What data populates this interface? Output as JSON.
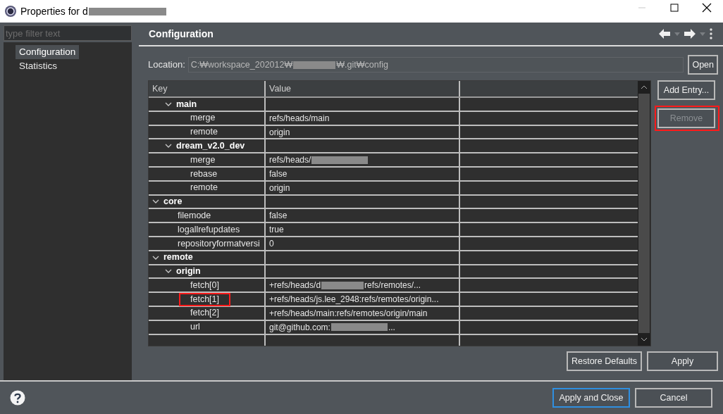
{
  "window": {
    "title": "Properties for d",
    "redacted": true
  },
  "sidebar": {
    "filter": {
      "placeholder": "type filter text"
    },
    "items": [
      {
        "label": "Configuration",
        "selected": true
      },
      {
        "label": "Statistics",
        "selected": false
      }
    ]
  },
  "page": {
    "title": "Configuration"
  },
  "location": {
    "label": "Location:",
    "value": "C:₩workspace_202012₩",
    "redacted": true,
    "value_tail": "₩.git₩config",
    "button": "Open"
  },
  "table": {
    "columns": [
      "Key",
      "Value"
    ],
    "tree": [
      {
        "children": [
          {
            "key": "main",
            "expanded": true,
            "children": [
              {
                "key": "merge",
                "value": "refs/heads/main"
              },
              {
                "key": "remote",
                "value": "origin"
              }
            ]
          },
          {
            "key": "dream_v2.0_dev",
            "expanded": true,
            "children": [
              {
                "key": "merge",
                "value": "refs/heads/",
                "redacted": true
              },
              {
                "key": "rebase",
                "value": "false"
              },
              {
                "key": "remote",
                "value": "origin"
              }
            ]
          }
        ]
      },
      {
        "key": "core",
        "expanded": true,
        "children": [
          {
            "key": "filemode",
            "value": "false"
          },
          {
            "key": "logallrefupdates",
            "value": "true"
          },
          {
            "key": "repositoryformatversi",
            "value": "0"
          }
        ]
      },
      {
        "key": "remote",
        "expanded": true,
        "children": [
          {
            "key": "origin",
            "expanded": true,
            "children": [
              {
                "key": "fetch[0]",
                "value": "+refs/heads/d",
                "redacted": true,
                "value_tail": "refs/remotes/..."
              },
              {
                "key": "fetch[1]",
                "value": "+refs/heads/js.lee_2948:refs/remotes/origin...",
                "highlighted": true
              },
              {
                "key": "fetch[2]",
                "value": "+refs/heads/main:refs/remotes/origin/main"
              },
              {
                "key": "url",
                "value": "git@github.com:",
                "redacted": true,
                "value_tail": "..."
              }
            ]
          }
        ]
      }
    ]
  },
  "side_buttons": [
    {
      "label": "Add Entry...",
      "disabled": false,
      "highlighted": false
    },
    {
      "label": "Remove",
      "disabled": true,
      "highlighted": true
    }
  ],
  "page_buttons": [
    "Restore Defaults",
    "Apply"
  ],
  "dialog_buttons": [
    {
      "label": "Apply and Close",
      "default": true
    },
    {
      "label": "Cancel",
      "default": false
    }
  ]
}
